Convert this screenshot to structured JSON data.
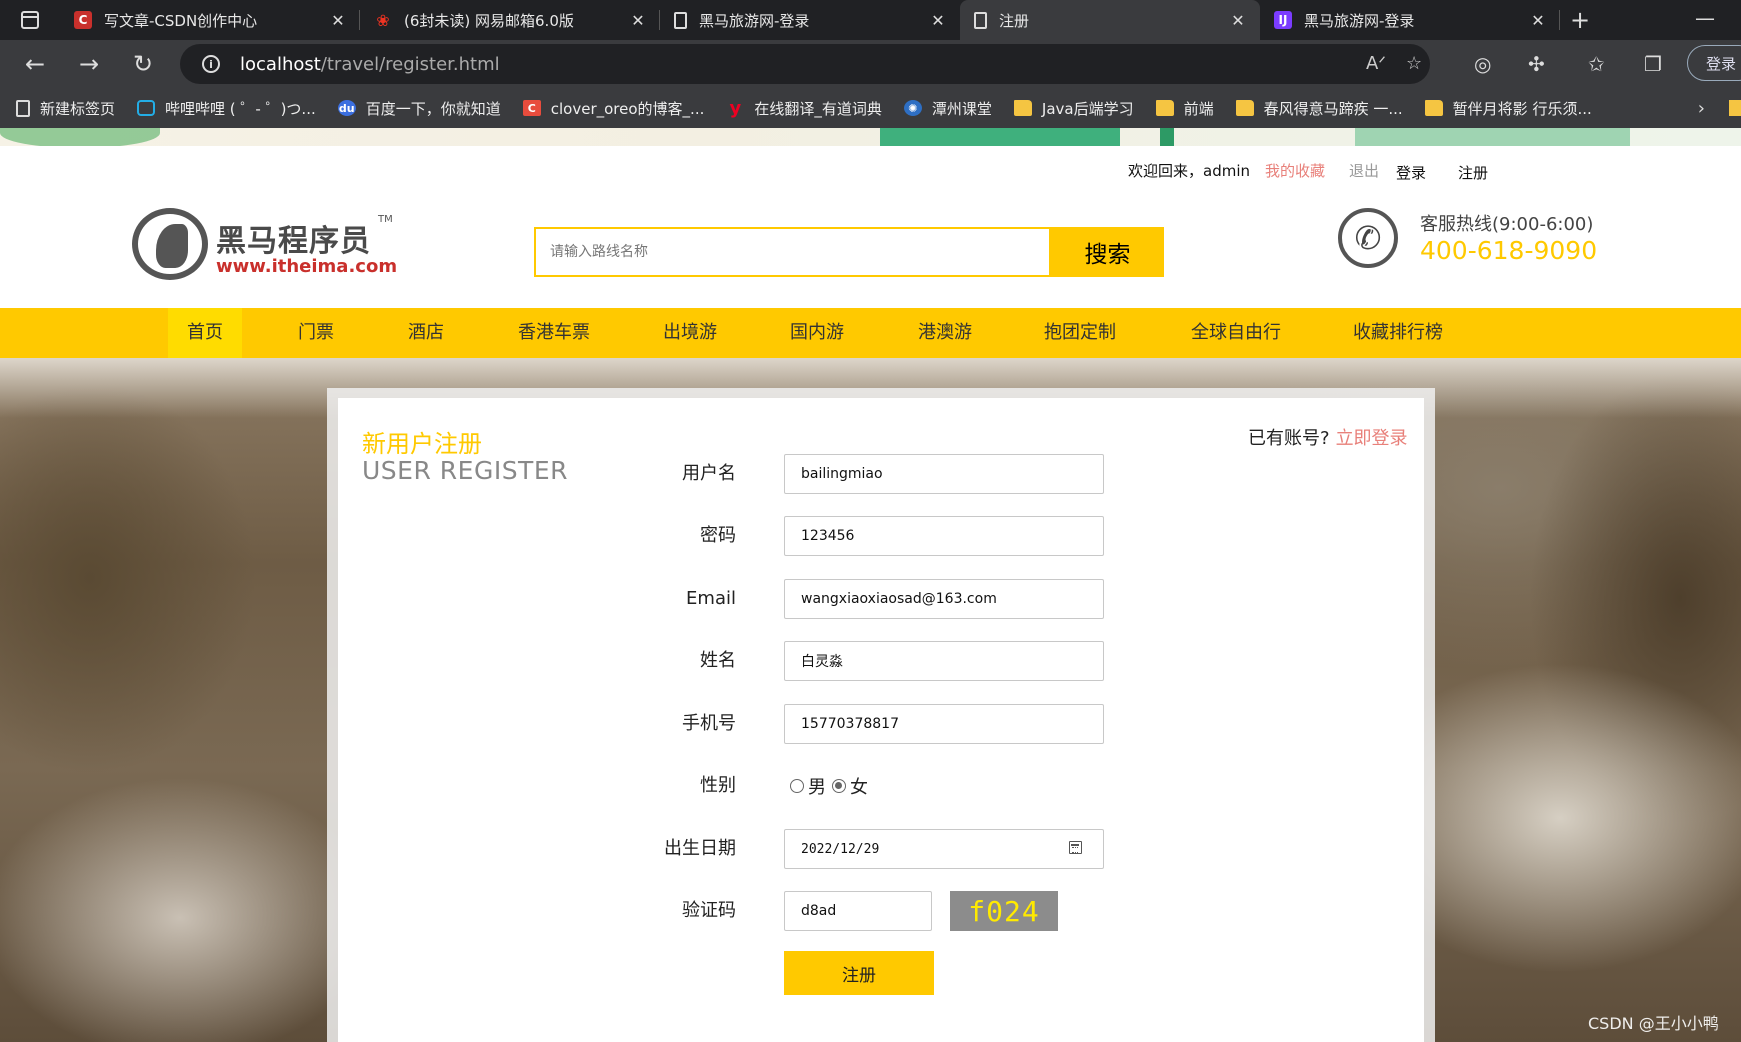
{
  "browser": {
    "tabs": [
      {
        "title": "写文章-CSDN创作中心",
        "icon": "csdn-icon",
        "active": false
      },
      {
        "title": "(6封未读) 网易邮箱6.0版",
        "icon": "netease-mail-icon",
        "active": false
      },
      {
        "title": "黑马旅游网-登录",
        "icon": "page-icon",
        "active": false
      },
      {
        "title": "注册",
        "icon": "page-icon",
        "active": true
      },
      {
        "title": "黑马旅游网-登录",
        "icon": "intellij-icon",
        "active": false
      }
    ],
    "url_host": "localhost",
    "url_path": "/travel/register.html",
    "profile_button": "登录",
    "bookmarks": [
      {
        "label": "新建标签页",
        "icon": "page-icon"
      },
      {
        "label": "哔哩哔哩 ( ゜- ゜)つ...",
        "icon": "bilibili-icon"
      },
      {
        "label": "百度一下，你就知道",
        "icon": "baidu-icon"
      },
      {
        "label": "clover_oreo的博客_...",
        "icon": "csdn-icon"
      },
      {
        "label": "在线翻译_有道词典",
        "icon": "youdao-icon"
      },
      {
        "label": "潭州课堂",
        "icon": "tanzhou-icon"
      },
      {
        "label": "Java后端学习",
        "icon": "folder-icon"
      },
      {
        "label": "前端",
        "icon": "folder-icon"
      },
      {
        "label": "春风得意马蹄疾 一...",
        "icon": "folder-icon"
      },
      {
        "label": "暂伴月将影 行乐须...",
        "icon": "folder-icon"
      }
    ]
  },
  "header": {
    "welcome": "欢迎回来，admin",
    "my_favorites": "我的收藏",
    "logout": "退出",
    "login": "登录",
    "register": "注册",
    "logo_cn": "黑马程序员",
    "logo_tm": "TM",
    "logo_en": "www.itheima.com",
    "search_placeholder": "请输入路线名称",
    "search_button": "搜索",
    "hotline_title": "客服热线(9:00-6:00)",
    "hotline_number": "400-618-9090"
  },
  "nav": [
    "首页",
    "门票",
    "酒店",
    "香港车票",
    "出境游",
    "国内游",
    "港澳游",
    "抱团定制",
    "全球自由行",
    "收藏排行榜"
  ],
  "form": {
    "title_cn": "新用户注册",
    "title_en": "USER REGISTER",
    "have_account": "已有账号?",
    "login_now": "立即登录",
    "fields": {
      "username": {
        "label": "用户名",
        "value": "bailingmiao"
      },
      "password": {
        "label": "密码",
        "value": "123456"
      },
      "email": {
        "label": "Email",
        "value": "wangxiaoxiaosad@163.com"
      },
      "name": {
        "label": "姓名",
        "value": "白灵淼"
      },
      "phone": {
        "label": "手机号",
        "value": "15770378817"
      },
      "gender": {
        "label": "性别",
        "male": "男",
        "female": "女",
        "selected": "女"
      },
      "birthday": {
        "label": "出生日期",
        "value": "2022/12/29"
      },
      "captcha": {
        "label": "验证码",
        "value": "d8ad",
        "image_text": "f024"
      }
    },
    "submit": "注册"
  },
  "watermark": "CSDN @王小小鸭",
  "colors": {
    "accent_yellow": "#ffc900",
    "link_pink": "#e8807a"
  }
}
